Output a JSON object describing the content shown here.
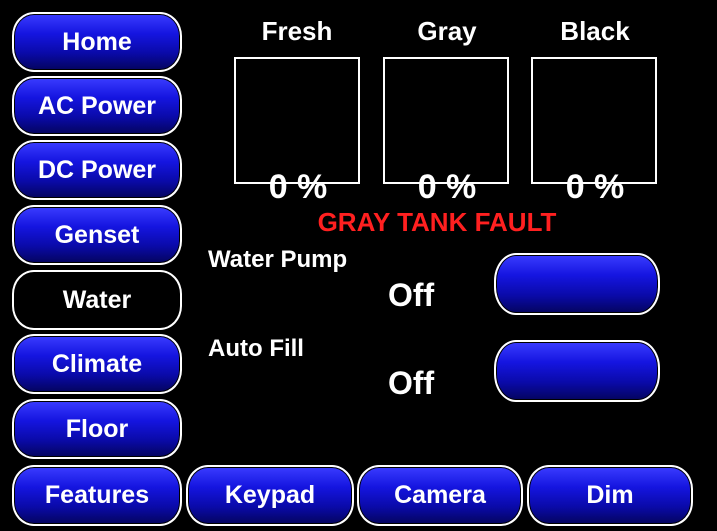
{
  "nav": {
    "items": [
      {
        "label": "Home",
        "active": false
      },
      {
        "label": "AC Power",
        "active": false
      },
      {
        "label": "DC Power",
        "active": false
      },
      {
        "label": "Genset",
        "active": false
      },
      {
        "label": "Water",
        "active": true
      },
      {
        "label": "Climate",
        "active": false
      },
      {
        "label": "Floor",
        "active": false
      },
      {
        "label": "Features",
        "active": false
      }
    ]
  },
  "bottom": {
    "keypad": "Keypad",
    "camera": "Camera",
    "dim": "Dim"
  },
  "tanks": [
    {
      "name": "Fresh",
      "level": "0 %"
    },
    {
      "name": "Gray",
      "level": "0 %"
    },
    {
      "name": "Black",
      "level": "0 %"
    }
  ],
  "fault": "GRAY TANK FAULT",
  "water_pump": {
    "label": "Water Pump",
    "state": "Off"
  },
  "auto_fill": {
    "label": "Auto Fill",
    "state": "Off"
  },
  "colors": {
    "background": "#000000",
    "button": "#1515e0",
    "fault": "#ff2020",
    "text": "#ffffff"
  }
}
